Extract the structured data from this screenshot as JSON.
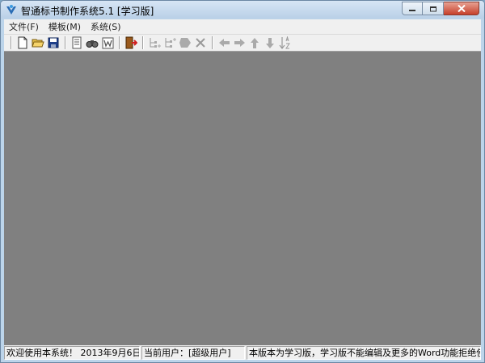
{
  "window": {
    "title": "智通标书制作系统5.1 [学习版]"
  },
  "menubar": {
    "items": [
      {
        "label": "文件(F)"
      },
      {
        "label": "模板(M)"
      },
      {
        "label": "系统(S)"
      }
    ]
  },
  "toolbar": {
    "buttons": [
      {
        "icon": "new-document-icon"
      },
      {
        "icon": "open-folder-icon"
      },
      {
        "icon": "save-icon"
      },
      {
        "icon": "properties-icon"
      },
      {
        "icon": "find-icon"
      },
      {
        "icon": "word-export-icon"
      },
      {
        "icon": "exit-icon"
      },
      {
        "icon": "add-child-node-icon"
      },
      {
        "icon": "add-sibling-node-icon"
      },
      {
        "icon": "delete-node-icon"
      },
      {
        "icon": "delete-icon"
      },
      {
        "icon": "arrow-left-icon"
      },
      {
        "icon": "arrow-right-icon"
      },
      {
        "icon": "arrow-up-icon"
      },
      {
        "icon": "arrow-down-icon"
      },
      {
        "icon": "sort-icon"
      }
    ]
  },
  "statusbar": {
    "welcome": "欢迎使用本系统！  2013年9月6日",
    "user": "当前用户：[超级用户]",
    "notice": "本版本为学习版，学习版不能编辑及更多的Word功能拒绝使用！"
  },
  "colors": {
    "client_background": "#808080",
    "title_bar": "#bcd4ea",
    "close_button": "#c6402b"
  }
}
